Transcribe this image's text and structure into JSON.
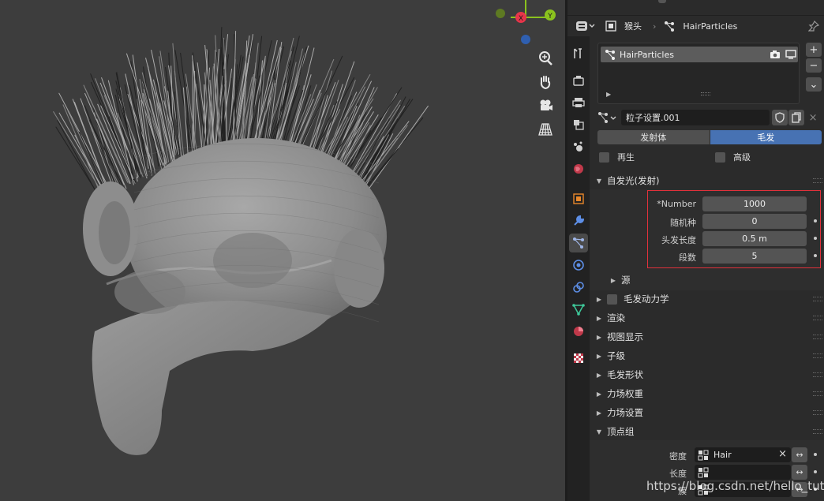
{
  "colors": {
    "accent": "#4772b3",
    "highlight_red": "#e2313b",
    "axis_x": "#e8354a",
    "axis_y": "#8bc21e",
    "axis_z": "#2f6fd6"
  },
  "viewport": {
    "gizmo": {
      "x_label": "X",
      "y_label": "Y"
    },
    "tools": [
      "zoom-icon",
      "hand-pan-icon",
      "camera-icon",
      "grid-perspective-icon"
    ]
  },
  "header": {
    "object_name": "猴头",
    "particle_system_name": "HairParticles"
  },
  "particle_list": {
    "items": [
      {
        "label": "HairParticles"
      }
    ],
    "add_label": "+",
    "remove_label": "−",
    "menu_label": "⌄"
  },
  "particle_settings": {
    "name": "粒子设置.001"
  },
  "type_toggle": {
    "emitter": "发射体",
    "hair": "毛发",
    "selected": "hair"
  },
  "checks": {
    "regrow": "再生",
    "advanced": "高级"
  },
  "panels": {
    "emission": {
      "title": "自发光(发射)",
      "rows": [
        {
          "label": "*Number",
          "value": "1000"
        },
        {
          "label": "随机种",
          "value": "0"
        },
        {
          "label": "头发长度",
          "value": "0.5 m"
        },
        {
          "label": "段数",
          "value": "5"
        }
      ],
      "source": "源"
    },
    "hair_dynamics": "毛发动力学",
    "render": "渲染",
    "viewport_display": "视图显示",
    "children": "子级",
    "hair_shape": "毛发形状",
    "field_weights": "力场权重",
    "force_settings": "力场设置",
    "vertex_groups": {
      "title": "顶点组",
      "rows": [
        {
          "label": "密度",
          "value": "Hair"
        },
        {
          "label": "长度",
          "value": ""
        },
        {
          "label": "簇",
          "value": ""
        }
      ]
    }
  },
  "watermark": "https://blog.csdn.net/hello_tute"
}
